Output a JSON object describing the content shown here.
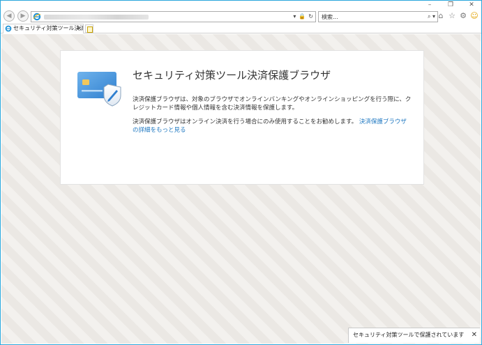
{
  "window": {
    "controls": {
      "minimize": "–",
      "restore": "❐",
      "close": "✕"
    }
  },
  "nav": {
    "back_glyph": "◀",
    "forward_glyph": "▶",
    "address_tools": [
      "▾",
      "🔒",
      "↻"
    ],
    "search_placeholder": "検索...",
    "search_tools": "⌕ ▾",
    "icons": [
      "home-icon",
      "favorites-star-icon",
      "tools-gear-icon",
      "feedback-smiley-icon"
    ]
  },
  "tab": {
    "label": "セキュリティ対策ツール決済保...",
    "close": "×"
  },
  "card": {
    "title": "セキュリティ対策ツール決済保護ブラウザ",
    "paragraph1": "決済保護ブラウザは、対象のブラウザでオンラインバンキングやオンラインショッピングを行う際に、クレジットカード情報や個人情報を含む決済情報を保護します。",
    "paragraph2": "決済保護ブラウザはオンライン決済を行う場合にのみ使用することをお勧めします。",
    "link": "決済保護ブラウザの詳細をもっと見る"
  },
  "notification": {
    "text": "セキュリティ対策ツールで保護されています",
    "close": "✕"
  },
  "colors": {
    "window_border": "#2aa7dc",
    "link": "#1f78c1",
    "card_blue": "#4a90d9"
  }
}
